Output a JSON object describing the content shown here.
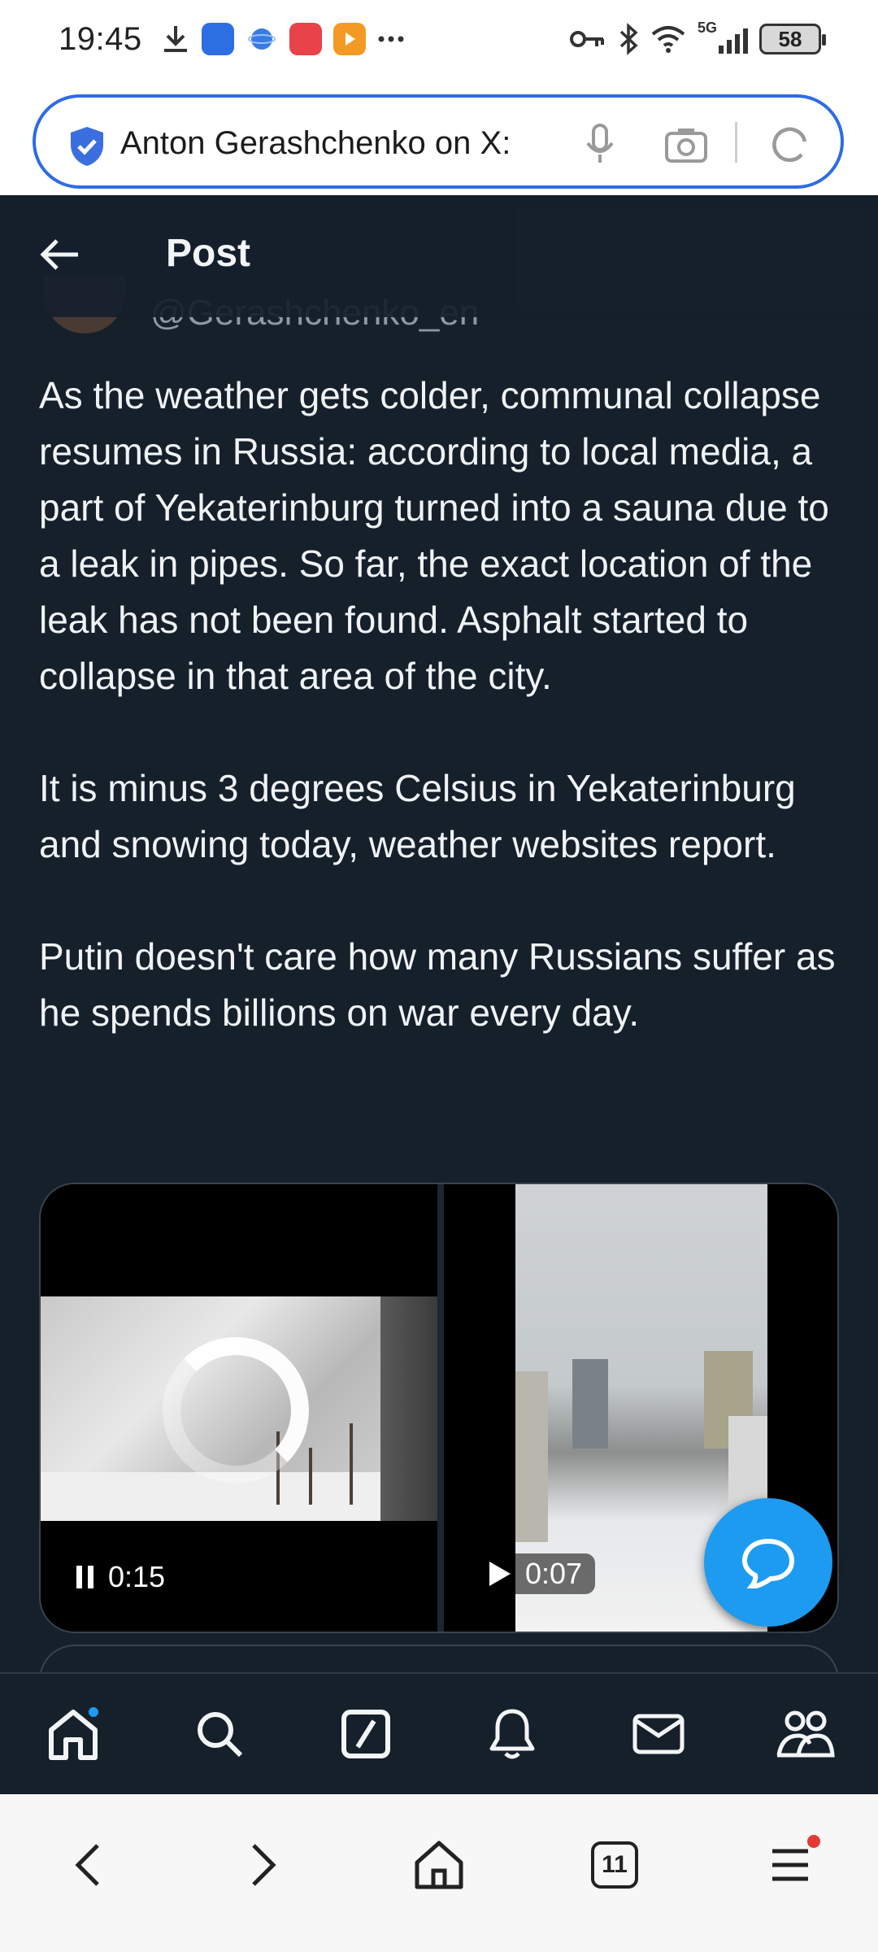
{
  "status_bar": {
    "time": "19:45",
    "network": "5G",
    "battery": "58"
  },
  "address_bar": {
    "url_title": "Anton Gerashchenko on X:"
  },
  "header": {
    "title": "Post",
    "author_handle": "@Gerashchenko_en"
  },
  "post": {
    "paragraphs": [
      "As the weather gets colder, communal collapse resumes in Russia: according to local media, a part of Yekaterinburg turned into a sauna due to a leak in pipes. So far, the exact location of the leak has not been found. Asphalt started to collapse in that area of the city.",
      "It is minus 3 degrees Celsius in Yekaterinburg and snowing today, weather websites report.",
      "Putin doesn't care how many Russians suffer as he spends billions on war every day."
    ]
  },
  "media": {
    "videos": [
      {
        "time": "0:15",
        "state": "playing"
      },
      {
        "time": "0:07",
        "state": "paused"
      }
    ]
  },
  "tw_nav": {
    "items": [
      "home-icon",
      "search-icon",
      "grok-icon",
      "notifications-icon",
      "messages-icon",
      "communities-icon"
    ]
  },
  "browser_bar": {
    "tabs_count": "11"
  },
  "colors": {
    "background": "#15202b",
    "accent": "#1d9bf0",
    "address_border": "#2e6be6"
  }
}
